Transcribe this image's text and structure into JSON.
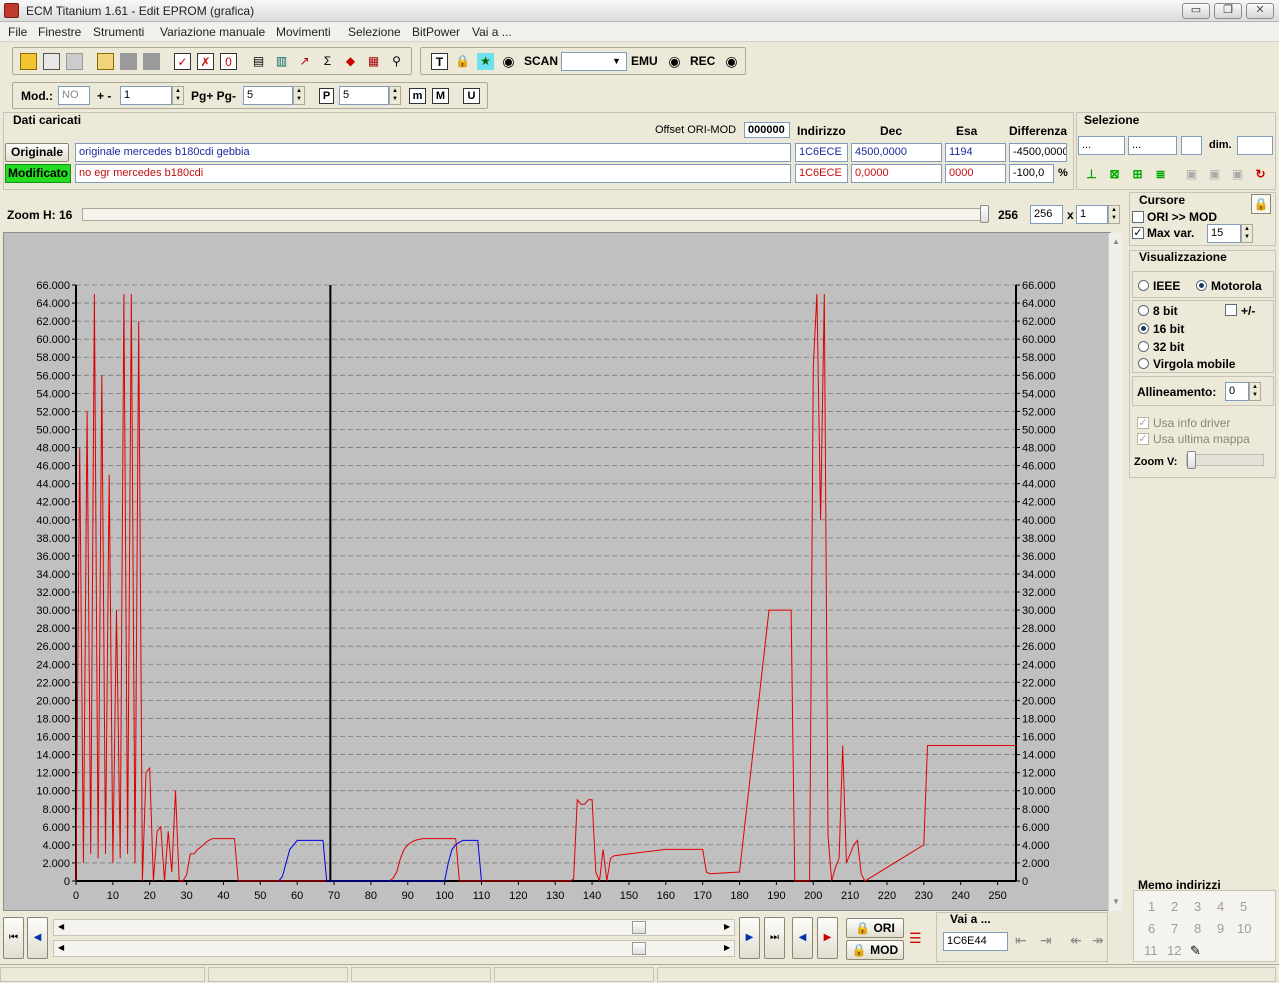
{
  "window": {
    "title": "ECM Titanium 1.61 - Edit EPROM (grafica)",
    "minimize_glyph": "▭",
    "restore_glyph": "❐",
    "close_glyph": "✕"
  },
  "menu": [
    "File",
    "Finestre",
    "Strumenti",
    "Variazione manuale",
    "Movimenti",
    "Selezione",
    "BitPower",
    "Vai a ..."
  ],
  "toolbar": {
    "scan_label": "SCAN",
    "emu_label": "EMU",
    "rec_label": "REC",
    "scan_value": ""
  },
  "toolbar2": {
    "mod_label": "Mod.:",
    "mod_value": "NO",
    "plusminus_label": "+ -",
    "plusminus_value": "1",
    "pg_label": "Pg+ Pg-",
    "pg_value": "5",
    "p_label": "P",
    "p_value": "5",
    "m_small": "m",
    "m_big": "M",
    "u_label": "U"
  },
  "loaded": {
    "section_title": "Dati caricati",
    "offset_label": "Offset ORI-MOD",
    "offset_value": "000000",
    "headers": {
      "indirizzo": "Indirizzo",
      "dec": "Dec",
      "esa": "Esa",
      "differenza": "Differenza"
    },
    "original": {
      "label": "Originale",
      "name": "originale mercedes b180cdi gebbia",
      "address": "1C6ECE",
      "dec": "4500,0000",
      "hex": "1194",
      "diff": "-4500,0000"
    },
    "modified": {
      "label": "Modificato",
      "name": "no egr mercedes b180cdi",
      "address": "1C6ECE",
      "dec": "0,0000",
      "hex": "0000",
      "diff": "-100,0",
      "diff_unit": "%"
    }
  },
  "selection": {
    "title": "Selezione",
    "field1": "...",
    "field2": "...",
    "dim_label": "dim."
  },
  "zoom": {
    "label": "Zoom H: 16",
    "value1": "256",
    "value2": "256",
    "x_label": "x",
    "value3": "1"
  },
  "cursor_panel": {
    "title": "Cursore",
    "ori_mod_label": "ORI >> MOD",
    "ori_mod_checked": false,
    "max_var_label": "Max var.",
    "max_var_checked": true,
    "max_var_value": "15"
  },
  "visual_panel": {
    "title": "Visualizzazione",
    "ieee_label": "IEEE",
    "motorola_label": "Motorola",
    "bit8_label": "8 bit",
    "plusminus_label": "+/-",
    "bit16_label": "16 bit",
    "bit32_label": "32 bit",
    "float_label": "Virgola mobile",
    "align_label": "Allineamento:",
    "align_value": "0",
    "driver_info_label": "Usa info driver",
    "last_map_label": "Usa ultima mappa",
    "zoomv_label": "Zoom V:"
  },
  "memo": {
    "title": "Memo indirizzi",
    "numbers": [
      "1",
      "2",
      "3",
      "4",
      "5",
      "6",
      "7",
      "8",
      "9",
      "10",
      "11",
      "12"
    ]
  },
  "bottom": {
    "ori_label": "ORI",
    "mod_label": "MOD",
    "goto_label": "Vai a ...",
    "goto_value": "1C6E44"
  },
  "colors": {
    "modified_line": "#e00000",
    "original_line": "#0000e0",
    "cursor_line": "#000000",
    "modified_badge": "#22dd22",
    "plot_bg": "#c0c0c0"
  },
  "chart_data": {
    "type": "line",
    "xlim": [
      0,
      255
    ],
    "ylim": [
      0,
      66000
    ],
    "xticks": [
      0,
      10,
      20,
      30,
      40,
      50,
      60,
      70,
      80,
      90,
      100,
      110,
      120,
      130,
      140,
      150,
      160,
      170,
      180,
      190,
      200,
      210,
      220,
      230,
      240,
      250
    ],
    "yticks": [
      0,
      2000,
      4000,
      6000,
      8000,
      10000,
      12000,
      14000,
      16000,
      18000,
      20000,
      22000,
      24000,
      26000,
      28000,
      30000,
      32000,
      34000,
      36000,
      38000,
      40000,
      42000,
      44000,
      46000,
      48000,
      50000,
      52000,
      54000,
      56000,
      58000,
      60000,
      62000,
      64000,
      66000
    ],
    "ytick_labels": [
      "0",
      "2.000",
      "4.000",
      "6.000",
      "8.000",
      "10.000",
      "12.000",
      "14.000",
      "16.000",
      "18.000",
      "20.000",
      "22.000",
      "24.000",
      "26.000",
      "28.000",
      "30.000",
      "32.000",
      "34.000",
      "36.000",
      "38.000",
      "40.000",
      "42.000",
      "44.000",
      "46.000",
      "48.000",
      "50.000",
      "52.000",
      "54.000",
      "56.000",
      "58.000",
      "60.000",
      "62.000",
      "64.000",
      "66.000"
    ],
    "grid": true,
    "cursor_x": 69,
    "series": [
      {
        "values": [
          [
            0,
            0
          ],
          [
            1,
            48000
          ],
          [
            2,
            2000
          ],
          [
            3,
            52000
          ],
          [
            4,
            3000
          ],
          [
            5,
            65000
          ],
          [
            6,
            2500
          ],
          [
            7,
            56000
          ],
          [
            8,
            3000
          ],
          [
            9,
            45000
          ],
          [
            10,
            2000
          ],
          [
            11,
            30000
          ],
          [
            12,
            2500
          ],
          [
            13,
            65000
          ],
          [
            14,
            3000
          ],
          [
            15,
            65000
          ],
          [
            16,
            2000
          ],
          [
            17,
            62000
          ],
          [
            18,
            0
          ],
          [
            19,
            12000
          ],
          [
            20,
            12500
          ],
          [
            21,
            0
          ],
          [
            22,
            5500
          ],
          [
            23,
            6000
          ],
          [
            24,
            0
          ],
          [
            25,
            5500
          ],
          [
            26,
            1000
          ],
          [
            27,
            10000
          ],
          [
            28,
            0
          ],
          [
            29,
            0
          ],
          [
            30,
            700
          ],
          [
            31,
            3000
          ],
          [
            32,
            3000
          ],
          [
            33,
            3500
          ],
          [
            34,
            3800
          ],
          [
            35,
            4200
          ],
          [
            36,
            4500
          ],
          [
            37,
            4700
          ],
          [
            38,
            4700
          ],
          [
            39,
            4700
          ],
          [
            40,
            4700
          ],
          [
            41,
            4700
          ],
          [
            42,
            4700
          ],
          [
            43,
            4700
          ],
          [
            44,
            0
          ],
          [
            45,
            0
          ],
          [
            69,
            0
          ],
          [
            70,
            0
          ],
          [
            71,
            0
          ],
          [
            72,
            0
          ],
          [
            75,
            0
          ],
          [
            80,
            0
          ],
          [
            85,
            0
          ],
          [
            86,
            300
          ],
          [
            87,
            1000
          ],
          [
            88,
            2500
          ],
          [
            89,
            3500
          ],
          [
            90,
            4000
          ],
          [
            91,
            4300
          ],
          [
            92,
            4500
          ],
          [
            93,
            4600
          ],
          [
            94,
            4700
          ],
          [
            95,
            4700
          ],
          [
            96,
            4700
          ],
          [
            97,
            4700
          ],
          [
            98,
            4700
          ],
          [
            99,
            4700
          ],
          [
            100,
            4700
          ],
          [
            101,
            4700
          ],
          [
            102,
            4700
          ],
          [
            103,
            4700
          ],
          [
            104,
            0
          ],
          [
            105,
            0
          ],
          [
            134,
            0
          ],
          [
            135,
            200
          ],
          [
            136,
            9000
          ],
          [
            137,
            8500
          ],
          [
            138,
            8500
          ],
          [
            139,
            9000
          ],
          [
            140,
            9000
          ],
          [
            141,
            1000
          ],
          [
            142,
            0
          ],
          [
            143,
            3500
          ],
          [
            144,
            0
          ],
          [
            145,
            2500
          ],
          [
            146,
            2800
          ],
          [
            160,
            3500
          ],
          [
            170,
            3500
          ],
          [
            171,
            1000
          ],
          [
            172,
            800
          ],
          [
            180,
            1000
          ],
          [
            188,
            30000
          ],
          [
            189,
            30000
          ],
          [
            190,
            30000
          ],
          [
            191,
            30000
          ],
          [
            192,
            30000
          ],
          [
            193,
            30000
          ],
          [
            194,
            30000
          ],
          [
            195,
            0
          ],
          [
            199,
            0
          ],
          [
            200,
            57000
          ],
          [
            201,
            65000
          ],
          [
            202,
            40000
          ],
          [
            203,
            65000
          ],
          [
            204,
            5000
          ],
          [
            205,
            0
          ],
          [
            206,
            1500
          ],
          [
            207,
            2500
          ],
          [
            208,
            15000
          ],
          [
            209,
            2000
          ],
          [
            210,
            3000
          ],
          [
            211,
            4000
          ],
          [
            212,
            4500
          ],
          [
            213,
            800
          ],
          [
            214,
            0
          ],
          [
            230,
            4000
          ],
          [
            231,
            15000
          ],
          [
            232,
            15000
          ],
          [
            233,
            15000
          ],
          [
            234,
            15000
          ],
          [
            235,
            15000
          ],
          [
            240,
            15000
          ],
          [
            245,
            15000
          ],
          [
            250,
            15000
          ],
          [
            255,
            15000
          ]
        ]
      },
      {
        "values": [
          [
            55,
            0
          ],
          [
            56,
            500
          ],
          [
            57,
            2000
          ],
          [
            58,
            3500
          ],
          [
            59,
            4000
          ],
          [
            60,
            4500
          ],
          [
            61,
            4500
          ],
          [
            62,
            4500
          ],
          [
            63,
            4500
          ],
          [
            64,
            4500
          ],
          [
            65,
            4500
          ],
          [
            66,
            4500
          ],
          [
            67,
            4500
          ],
          [
            68,
            0
          ],
          [
            100,
            0
          ],
          [
            101,
            2000
          ],
          [
            102,
            3500
          ],
          [
            103,
            4000
          ],
          [
            104,
            4300
          ],
          [
            105,
            4500
          ],
          [
            106,
            4500
          ],
          [
            107,
            4500
          ],
          [
            108,
            4500
          ],
          [
            109,
            4500
          ],
          [
            110,
            0
          ]
        ]
      }
    ]
  }
}
